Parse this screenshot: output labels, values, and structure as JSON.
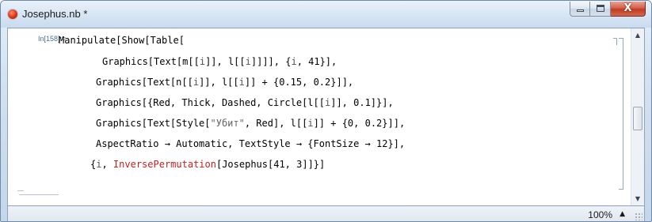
{
  "window": {
    "title": "Josephus.nb *",
    "icon": "mathematica-notebook-icon",
    "buttons": {
      "minimize": "minimize-icon",
      "maximize": "maximize-icon",
      "close_glyph": "X"
    }
  },
  "cell": {
    "label": "In[158]:=",
    "lines": [
      [
        {
          "t": "Manipulate[Show[Table[",
          "s": "n"
        }
      ],
      [
        {
          "t": "Graphics[Text[m[[",
          "s": "n"
        },
        {
          "t": "i",
          "s": "v"
        },
        {
          "t": "]], l[[",
          "s": "n"
        },
        {
          "t": "i",
          "s": "v"
        },
        {
          "t": "]]]], {",
          "s": "n"
        },
        {
          "t": "i",
          "s": "v"
        },
        {
          "t": ", 41}],",
          "s": "n"
        }
      ],
      [
        {
          "t": "Graphics[Text[n[[",
          "s": "n"
        },
        {
          "t": "i",
          "s": "v"
        },
        {
          "t": "]], l[[",
          "s": "n"
        },
        {
          "t": "i",
          "s": "v"
        },
        {
          "t": "]] + {0.15, 0.2}]],",
          "s": "n"
        }
      ],
      [
        {
          "t": "Graphics[{Red, Thick, Dashed, Circle[l[[",
          "s": "n"
        },
        {
          "t": "i",
          "s": "v"
        },
        {
          "t": "]], 0.1]}],",
          "s": "n"
        }
      ],
      [
        {
          "t": "Graphics[Text[Style[",
          "s": "n"
        },
        {
          "t": "\"Убит\"",
          "s": "s"
        },
        {
          "t": ", Red], l[[",
          "s": "n"
        },
        {
          "t": "i",
          "s": "v"
        },
        {
          "t": "]] + {0, 0.2}]],",
          "s": "n"
        }
      ],
      [
        {
          "t": "AspectRatio → Automatic, TextStyle → {FontSize → 12}],",
          "s": "n"
        }
      ],
      [
        {
          "t": "{",
          "s": "n"
        },
        {
          "t": "i",
          "s": "v"
        },
        {
          "t": ", ",
          "s": "n"
        },
        {
          "t": "InversePermutation",
          "s": "r"
        },
        {
          "t": "[Josephus[41, 3]]}]",
          "s": "n"
        }
      ]
    ]
  },
  "status": {
    "zoom": "100%",
    "zoom_arrow": "▲"
  },
  "scrollbar": {
    "up": "▲",
    "down": "▼"
  },
  "colors": {
    "accent_red": "#c81e1e",
    "label_blue": "#4f6b93",
    "window_frame": "#c4d6ea"
  }
}
